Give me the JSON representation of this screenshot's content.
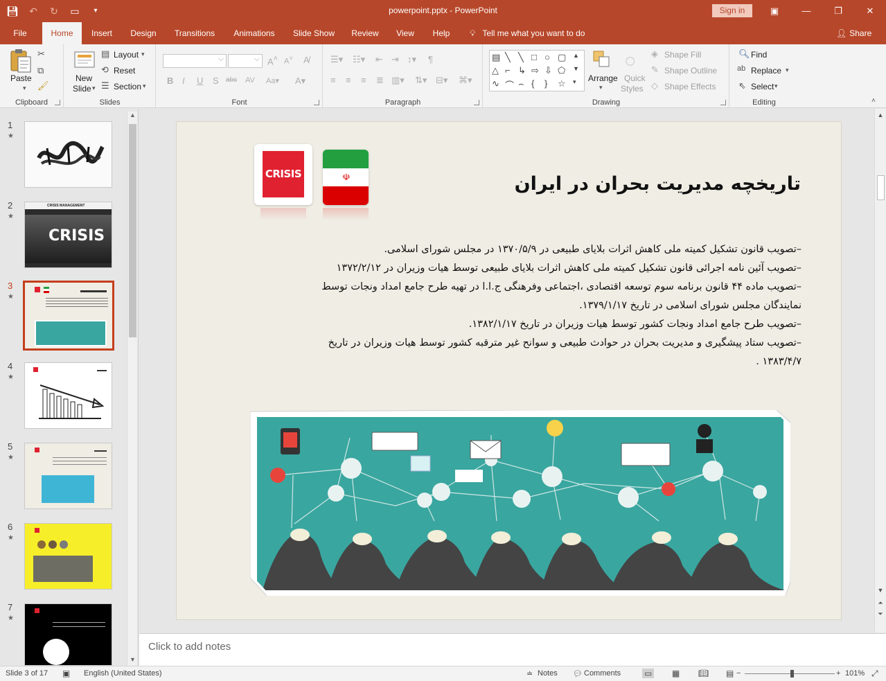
{
  "window": {
    "title": "powerpoint.pptx - PowerPoint",
    "signin": "Sign in"
  },
  "tabs": [
    {
      "label": "File"
    },
    {
      "label": "Home"
    },
    {
      "label": "Insert"
    },
    {
      "label": "Design"
    },
    {
      "label": "Transitions"
    },
    {
      "label": "Animations"
    },
    {
      "label": "Slide Show"
    },
    {
      "label": "Review"
    },
    {
      "label": "View"
    },
    {
      "label": "Help"
    }
  ],
  "tellme": "Tell me what you want to do",
  "share": "Share",
  "ribbon": {
    "clipboard": {
      "label": "Clipboard",
      "paste": "Paste"
    },
    "slides": {
      "label": "Slides",
      "new_slide_1": "New",
      "new_slide_2": "Slide",
      "layout": "Layout",
      "reset": "Reset",
      "section": "Section"
    },
    "font": {
      "label": "Font"
    },
    "paragraph": {
      "label": "Paragraph"
    },
    "drawing": {
      "label": "Drawing",
      "arrange": "Arrange",
      "quick_styles_1": "Quick",
      "quick_styles_2": "Styles",
      "shape_fill": "Shape Fill",
      "shape_outline": "Shape Outline",
      "shape_effects": "Shape Effects"
    },
    "editing": {
      "label": "Editing",
      "find": "Find",
      "replace": "Replace",
      "select": "Select"
    }
  },
  "thumbnails": [
    {
      "num": "1"
    },
    {
      "num": "2"
    },
    {
      "num": "3"
    },
    {
      "num": "4"
    },
    {
      "num": "5"
    },
    {
      "num": "6"
    },
    {
      "num": "7"
    }
  ],
  "thumb_text": {
    "crisis_management": "CRISIS MANAGEMENT",
    "crisis": "CRISIS"
  },
  "slide": {
    "title": "تاریخچه مدیریت بحران در ایران",
    "logo_text": "CRISIS",
    "lines": [
      "–تصویب قانون تشکیل کمیته ملی کاهش اثرات بلایای طبیعی در  ۱۳۷۰/۵/۹  در مجلس شورای اسلامی.",
      "–تصویب آئین نامه اجرائی قانون تشکیل کمیته ملی کاهش اثرات بلایای طبیعی توسط هیات وزیران در ۱۳۷۲/۲/۱۲",
      "–تصویب ماده ۴۴ قانون برنامه سوم توسعه اقتصادی ،اجتماعی وفرهنگی ج.ا.ا در تهیه طرح جامع امداد ونجات توسط",
      " نمایندگان مجلس شورای اسلامی در تاریخ ۱۳۷۹/۱/۱۷.",
      "–تصویب طرح جامع امداد ونجات کشور توسط هیات وزیران در تاریخ ۱۳۸۲/۱/۱۷.",
      "–تصویب ستاد پیشگیری و مدیریت بحران در حوادث طبیعی و سوانح غیر مترقبه کشور توسط هیات وزیران در تاریخ",
      " ۱۳۸۳/۴/۷ ."
    ]
  },
  "notes_placeholder": "Click to add notes",
  "status": {
    "slide": "Slide 3 of 17",
    "language": "English (United States)",
    "notes": "Notes",
    "comments": "Comments",
    "zoom": "101%"
  },
  "colors": {
    "accent": "#b7472a",
    "active_thumb": "#c43e1c",
    "slide_bg": "#efede4",
    "panel_teal": "#3aa6a0"
  }
}
